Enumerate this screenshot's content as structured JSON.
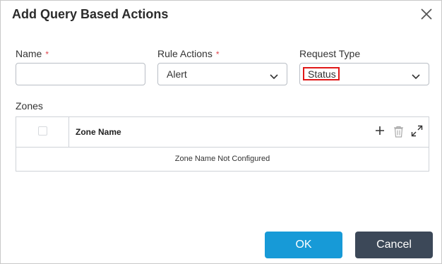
{
  "dialog": {
    "title": "Add Query Based Actions"
  },
  "form": {
    "name": {
      "label": "Name",
      "required_mark": "*",
      "value": ""
    },
    "rule_actions": {
      "label": "Rule Actions",
      "required_mark": "*",
      "value": "Alert"
    },
    "request_type": {
      "label": "Request Type",
      "value": "Status"
    }
  },
  "zones": {
    "label": "Zones",
    "column_header": "Zone Name",
    "empty_message": "Zone Name Not Configured",
    "icons": [
      "plus-icon",
      "trash-icon",
      "expand-icon"
    ]
  },
  "buttons": {
    "ok": "OK",
    "cancel": "Cancel"
  },
  "colors": {
    "primary": "#179ad7",
    "secondary": "#3c4858",
    "required": "#e0464e",
    "highlight": "#e01818"
  }
}
